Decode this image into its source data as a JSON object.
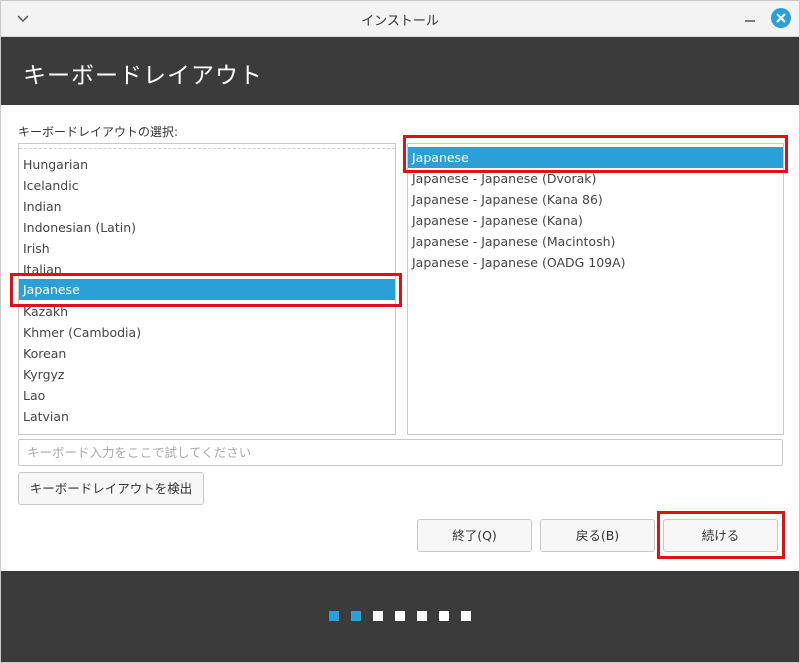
{
  "window": {
    "title": "インストール"
  },
  "header": {
    "title": "キーボードレイアウト"
  },
  "layout_section": {
    "label": "キーボードレイアウトの選択:"
  },
  "left_list": {
    "items": [
      {
        "label": "Hungarian",
        "selected": false
      },
      {
        "label": "Icelandic",
        "selected": false
      },
      {
        "label": "Indian",
        "selected": false
      },
      {
        "label": "Indonesian (Latin)",
        "selected": false
      },
      {
        "label": "Irish",
        "selected": false
      },
      {
        "label": "Italian",
        "selected": false
      },
      {
        "label": "Japanese",
        "selected": true
      },
      {
        "label": "Kazakh",
        "selected": false
      },
      {
        "label": "Khmer (Cambodia)",
        "selected": false
      },
      {
        "label": "Korean",
        "selected": false
      },
      {
        "label": "Kyrgyz",
        "selected": false
      },
      {
        "label": "Lao",
        "selected": false
      },
      {
        "label": "Latvian",
        "selected": false
      }
    ]
  },
  "right_list": {
    "items": [
      {
        "label": "Japanese",
        "selected": true
      },
      {
        "label": "Japanese - Japanese (Dvorak)",
        "selected": false
      },
      {
        "label": "Japanese - Japanese (Kana 86)",
        "selected": false
      },
      {
        "label": "Japanese - Japanese (Kana)",
        "selected": false
      },
      {
        "label": "Japanese - Japanese (Macintosh)",
        "selected": false
      },
      {
        "label": "Japanese - Japanese (OADG 109A)",
        "selected": false
      }
    ]
  },
  "test_field": {
    "placeholder": "キーボード入力をここで試してください",
    "value": ""
  },
  "buttons": {
    "detect": "キーボードレイアウトを検出",
    "quit": "終了(Q)",
    "back": "戻る(B)",
    "continue": "続ける"
  },
  "progress": {
    "total_steps": 7,
    "completed_steps": 2
  },
  "colors": {
    "accent": "#2b9fd8",
    "header_bg": "#3b3b3b",
    "highlight_box": "#e0101a",
    "dot_inactive": "#ffffff"
  },
  "icons": {
    "titlebar_menu": "chevron-down-icon",
    "minimize": "minimize-icon",
    "close": "close-icon"
  }
}
